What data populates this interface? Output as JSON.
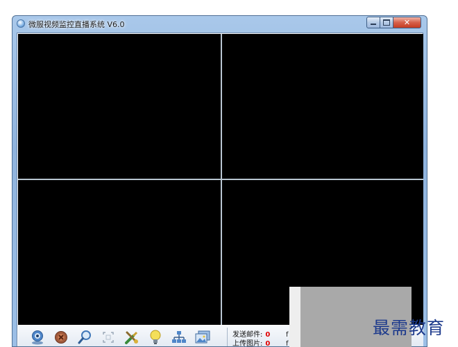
{
  "window": {
    "title": "微服视频监控直播系统 V6.0",
    "controls": {
      "close_glyph": "✕"
    }
  },
  "video_grid": {
    "cells": 4
  },
  "toolbar": {
    "buttons": [
      {
        "icon": "webcam-icon"
      },
      {
        "icon": "stop-icon"
      },
      {
        "icon": "search-icon"
      },
      {
        "icon": "capture-frame-icon"
      },
      {
        "icon": "tools-settings-icon"
      },
      {
        "icon": "lightbulb-icon"
      },
      {
        "icon": "network-icon"
      },
      {
        "icon": "photo-gallery-icon"
      }
    ]
  },
  "stats": {
    "email_label": "发送邮件:",
    "email_count": "0",
    "upload_label": "上传图片:",
    "upload_count": "0",
    "trail_1": "f",
    "trail_2": "f"
  },
  "watermark": {
    "text": "最需教育"
  },
  "colors": {
    "video_bg": "#000000",
    "count_red": "#e00000",
    "watermark_blue": "#1d3a8c"
  }
}
